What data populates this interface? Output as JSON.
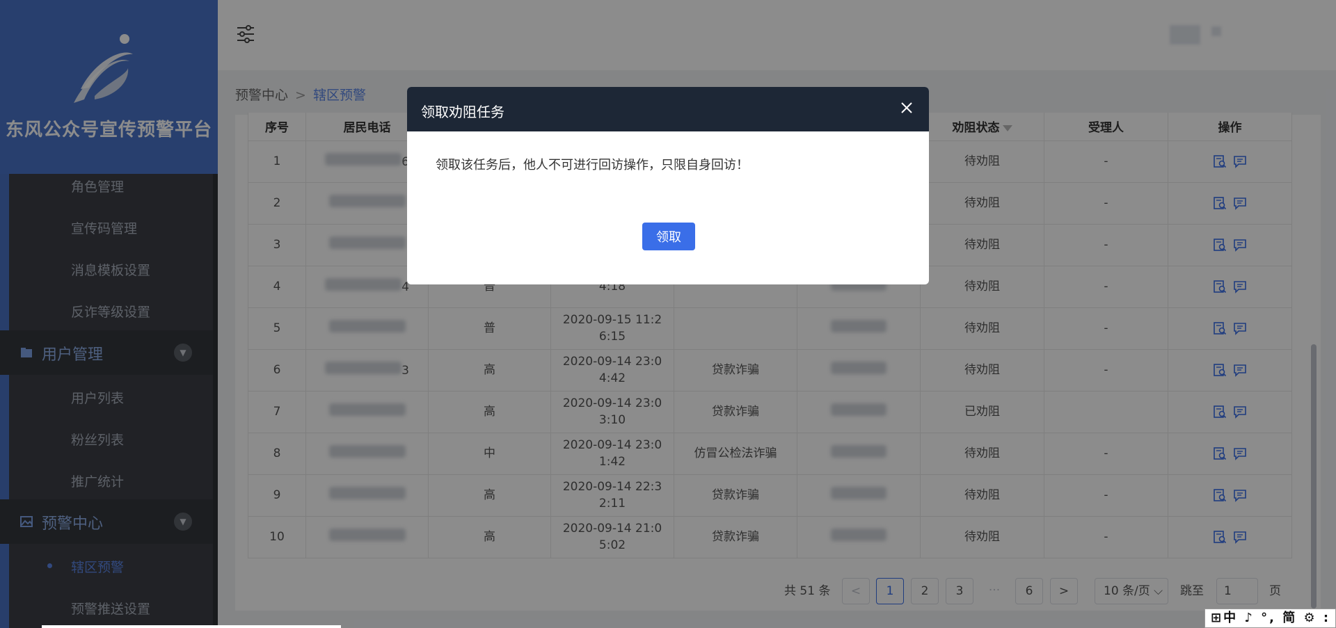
{
  "sidebar": {
    "brand_title": "东风公众号宣传预警平台",
    "sub_items_top": [
      "角色管理",
      "宣传码管理",
      "消息模板设置",
      "反诈等级设置"
    ],
    "groups": [
      {
        "label": "用户管理",
        "items": [
          "用户列表",
          "粉丝列表",
          "推广统计"
        ]
      },
      {
        "label": "预警中心",
        "items": [
          "辖区预警",
          "预警推送设置"
        ]
      }
    ],
    "active_item": "辖区预警"
  },
  "breadcrumb": {
    "root": "预警中心",
    "current": "辖区预警"
  },
  "table": {
    "headers": [
      "序号",
      "居民电话",
      "",
      "",
      "",
      "",
      "劝阻状态",
      "受理人",
      "操作"
    ],
    "rows": [
      {
        "no": "1",
        "phone_tail": "6",
        "level": "",
        "time": "",
        "type": "",
        "status": "待劝阻",
        "handler": "-"
      },
      {
        "no": "2",
        "phone_tail": "",
        "level": "",
        "time": "",
        "type": "",
        "status": "待劝阻",
        "handler": "-"
      },
      {
        "no": "3",
        "phone_tail": "",
        "level": "",
        "time": "",
        "type": "",
        "status": "待劝阻",
        "handler": "-"
      },
      {
        "no": "4",
        "phone_tail": "4",
        "level": "普",
        "time": "4:18",
        "type": "",
        "status": "待劝阻",
        "handler": "-"
      },
      {
        "no": "5",
        "phone_tail": "",
        "level": "普",
        "time": "2020-09-15 11:2 6:15",
        "type": "",
        "status": "待劝阻",
        "handler": "-"
      },
      {
        "no": "6",
        "phone_tail": "3",
        "level": "高",
        "time": "2020-09-14 23:0 4:42",
        "type": "贷款诈骗",
        "status": "待劝阻",
        "handler": "-"
      },
      {
        "no": "7",
        "phone_tail": "",
        "level": "高",
        "time": "2020-09-14 23:0 3:10",
        "type": "贷款诈骗",
        "status": "已劝阻",
        "handler": ""
      },
      {
        "no": "8",
        "phone_tail": "",
        "level": "中",
        "time": "2020-09-14 23:0 1:42",
        "type": "仿冒公检法诈骗",
        "status": "待劝阻",
        "handler": "-"
      },
      {
        "no": "9",
        "phone_tail": "",
        "level": "高",
        "time": "2020-09-14 22:3 2:11",
        "type": "贷款诈骗",
        "status": "待劝阻",
        "handler": "-"
      },
      {
        "no": "10",
        "phone_tail": "",
        "level": "高",
        "time": "2020-09-14 21:0 5:02",
        "type": "贷款诈骗",
        "status": "待劝阻",
        "handler": "-"
      }
    ]
  },
  "pagination": {
    "total": "共 51 条",
    "prev": "<",
    "pages": [
      "1",
      "2",
      "3",
      "···",
      "6"
    ],
    "next": ">",
    "page_size": "10 条/页",
    "jump_label": "跳至",
    "jump_value": "1",
    "page_suffix": "页"
  },
  "modal": {
    "title": "领取劝阻任务",
    "message": "领取该任务后，他人不可进行回访操作，只限自身回访！",
    "confirm_label": "领取"
  },
  "ime": {
    "text": "中 ♪ °, 简 ⚙ :"
  },
  "colors": {
    "primary": "#3a6ee8",
    "sidebar_bg": "#3c3f45",
    "brand_bg": "#4a74c8",
    "modal_header": "#1d2736",
    "status_wait": "#f2b118",
    "status_done": "#39b57a",
    "level_high": "#e6731e",
    "level_normal": "#4a90e2"
  }
}
